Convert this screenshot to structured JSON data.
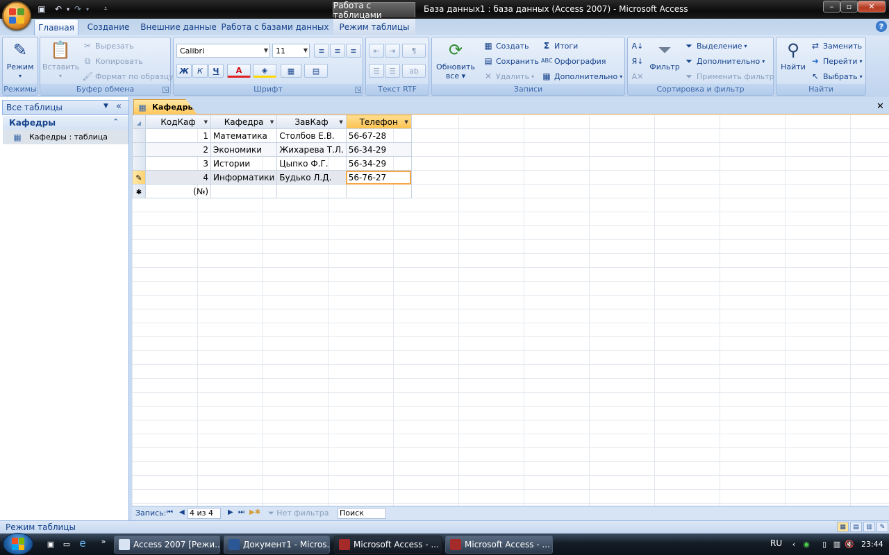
{
  "window": {
    "context_tab": "Работа с таблицами",
    "title": "База данных1 : база данных (Access 2007) - Microsoft Access",
    "minimize": "–",
    "maximize": "▫",
    "close": "✕"
  },
  "ribbon_tabs": [
    "Главная",
    "Создание",
    "Внешние данные",
    "Работа с базами данных",
    "Режим таблицы"
  ],
  "help_label": "?",
  "ribbon": {
    "modes": {
      "label": "Режимы",
      "view_line1": "Режим",
      "view_arrow": "▾"
    },
    "clipboard": {
      "label": "Буфер обмена",
      "paste": "Вставить",
      "paste_arrow": "▾",
      "cut": "Вырезать",
      "copy": "Копировать",
      "format_painter": "Формат по образцу"
    },
    "font": {
      "label": "Шрифт",
      "family": "Calibri",
      "size": "11",
      "bold": "Ж",
      "italic": "К",
      "underline": "Ч",
      "color_a": "A"
    },
    "rtf": {
      "label": "Текст RTF"
    },
    "records": {
      "label": "Записи",
      "refresh_line1": "Обновить",
      "refresh_line2": "все ▾",
      "new": "Создать",
      "save": "Сохранить",
      "delete": "Удалить",
      "totals": "Итоги",
      "spelling": "Орфография",
      "more": "Дополнительно"
    },
    "sort_filter": {
      "label": "Сортировка и фильтр",
      "filter": "Фильтр",
      "selection": "Выделение",
      "advanced": "Дополнительно",
      "toggle": "Применить фильтр"
    },
    "find": {
      "label": "Найти",
      "find": "Найти",
      "replace": "Заменить",
      "goto": "Перейти",
      "select": "Выбрать"
    }
  },
  "nav_pane": {
    "header": "Все таблицы",
    "group": "Кафедры",
    "item": "Кафедры : таблица",
    "collapse_glyph": "«",
    "group_glyph": "⌃"
  },
  "document": {
    "tab": "Кафедры",
    "close": "✕",
    "columns": [
      "КодКаф",
      "Кафедра",
      "ЗавКаф",
      "Телефон"
    ],
    "rows": [
      {
        "id": "1",
        "dept": "Математика",
        "head": "Столбов Е.В.",
        "phone": "56-67-28"
      },
      {
        "id": "2",
        "dept": "Экономики",
        "head": "Жихарева Т.Л.",
        "phone": "56-34-29"
      },
      {
        "id": "3",
        "dept": "Истории",
        "head": "Цыпко Ф.Г.",
        "phone": "56-34-29"
      },
      {
        "id": "4",
        "dept": "Информатики",
        "head": "Будько Л.Д.",
        "phone": "56-76-27"
      }
    ],
    "new_row_id": "(№)",
    "edit_glyph": "✎",
    "new_glyph": "✱"
  },
  "record_nav": {
    "label": "Запись:",
    "position": "4 из 4",
    "filter": "Нет фильтра",
    "search": "Поиск"
  },
  "status_bar": {
    "text": "Режим таблицы"
  },
  "taskbar": {
    "items": [
      "Access 2007 [Режи...",
      "Документ1 - Micros...",
      "Microsoft Access - ...",
      "Microsoft Access - ..."
    ],
    "overflow": "»",
    "lang": "RU",
    "time": "23:44"
  },
  "colors": {
    "accent": "#15428b",
    "ribbon": "#c9dbf1",
    "selection": "#fbc14f"
  }
}
